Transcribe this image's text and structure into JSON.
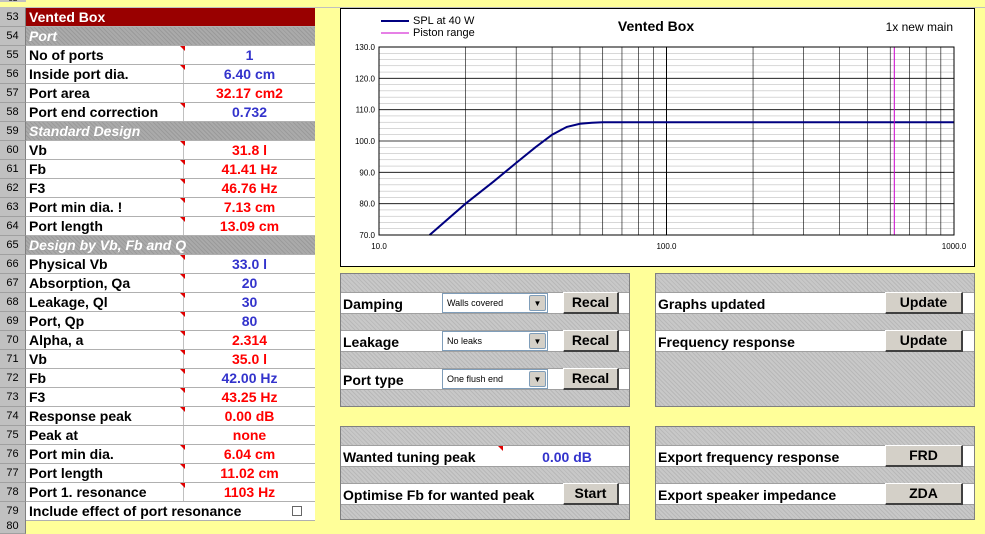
{
  "rows": [
    {
      "num": "53",
      "label": "Vented Box",
      "value": "",
      "style": "title"
    },
    {
      "num": "54",
      "label": "Port",
      "value": "",
      "style": "section"
    },
    {
      "num": "55",
      "label": "No of ports",
      "value": "1",
      "color": "blue",
      "tri": true
    },
    {
      "num": "56",
      "label": "Inside port dia.",
      "value": "6.40 cm",
      "color": "blue",
      "tri": true
    },
    {
      "num": "57",
      "label": "Port area",
      "value": "32.17 cm2",
      "color": "red",
      "tri": false
    },
    {
      "num": "58",
      "label": "Port end correction",
      "value": "0.732",
      "color": "blue",
      "tri": true
    },
    {
      "num": "59",
      "label": "Standard Design",
      "value": "",
      "style": "section"
    },
    {
      "num": "60",
      "label": "Vb",
      "value": "31.8 l",
      "color": "red",
      "tri": true
    },
    {
      "num": "61",
      "label": "Fb",
      "value": "41.41 Hz",
      "color": "red",
      "tri": true
    },
    {
      "num": "62",
      "label": "F3",
      "value": "46.76 Hz",
      "color": "red",
      "tri": true
    },
    {
      "num": "63",
      "label": "Port min dia. !",
      "value": "7.13 cm",
      "color": "red",
      "tri": true
    },
    {
      "num": "64",
      "label": "Port length",
      "value": "13.09 cm",
      "color": "red",
      "tri": true
    },
    {
      "num": "65",
      "label": "Design by Vb, Fb and Q",
      "value": "",
      "style": "section"
    },
    {
      "num": "66",
      "label": "Physical Vb",
      "value": "33.0 l",
      "color": "blue",
      "tri": true
    },
    {
      "num": "67",
      "label": "Absorption, Qa",
      "value": "20",
      "color": "blue",
      "tri": true
    },
    {
      "num": "68",
      "label": "Leakage, Ql",
      "value": "30",
      "color": "blue",
      "tri": true
    },
    {
      "num": "69",
      "label": "Port, Qp",
      "value": "80",
      "color": "blue",
      "tri": true
    },
    {
      "num": "70",
      "label": "Alpha, a",
      "value": "2.314",
      "color": "red",
      "tri": true
    },
    {
      "num": "71",
      "label": "Vb",
      "value": "35.0 l",
      "color": "red",
      "tri": true
    },
    {
      "num": "72",
      "label": "Fb",
      "value": "42.00 Hz",
      "color": "blue",
      "tri": true
    },
    {
      "num": "73",
      "label": "F3",
      "value": "43.25 Hz",
      "color": "red",
      "tri": true
    },
    {
      "num": "74",
      "label": "Response peak",
      "value": "0.00 dB",
      "color": "red",
      "tri": true
    },
    {
      "num": "75",
      "label": "Peak at",
      "value": "none",
      "color": "red",
      "tri": false
    },
    {
      "num": "76",
      "label": "Port min dia.",
      "value": "6.04 cm",
      "color": "red",
      "tri": true
    },
    {
      "num": "77",
      "label": "Port length",
      "value": "11.02 cm",
      "color": "red",
      "tri": true
    },
    {
      "num": "78",
      "label": "Port 1. resonance",
      "value": "1103 Hz",
      "color": "red",
      "tri": true
    },
    {
      "num": "79",
      "label": "Include effect of port resonance",
      "value": "",
      "checkbox": true
    }
  ],
  "row_header_top": "52",
  "row_header_bottom": "80",
  "chart": {
    "title": "Vented Box",
    "subtitle": "1x new main",
    "legend": [
      "SPL at 40 W",
      "Piston range"
    ]
  },
  "chart_data": {
    "type": "line",
    "title": "Vented Box",
    "x_scale": "log",
    "xlim": [
      10,
      1000
    ],
    "ylim": [
      70,
      130
    ],
    "x_ticks": [
      "10.0",
      "100.0",
      "1000.0"
    ],
    "y_ticks": [
      "70.0",
      "80.0",
      "90.0",
      "100.0",
      "110.0",
      "120.0",
      "130.0"
    ],
    "grid": true,
    "legend_position": "top-left",
    "series": [
      {
        "name": "SPL at 40 W",
        "color": "#000080",
        "x": [
          15,
          20,
          25,
          30,
          35,
          40,
          45,
          50,
          55,
          60,
          80,
          100,
          200,
          500,
          1000
        ],
        "y": [
          70,
          80,
          87,
          93,
          98,
          102,
          104.5,
          105.5,
          105.8,
          106,
          106,
          106,
          106,
          106,
          106
        ]
      },
      {
        "name": "Piston range",
        "color": "#cc00cc",
        "x": [
          620,
          620
        ],
        "y": [
          70,
          130
        ]
      }
    ]
  },
  "controls": {
    "damping_label": "Damping",
    "damping_value": "Walls covered",
    "leakage_label": "Leakage",
    "leakage_value": "No leaks",
    "porttype_label": "Port type",
    "porttype_value": "One flush end",
    "recal": "Recal",
    "graphs_updated": "Graphs updated",
    "frequency_response": "Frequency response",
    "update": "Update",
    "wanted_peak_label": "Wanted tuning peak",
    "wanted_peak_value": "0.00 dB",
    "optimise_label": "Optimise Fb for wanted peak",
    "start": "Start",
    "export_frd_label": "Export frequency response",
    "frd": "FRD",
    "export_zda_label": "Export speaker impedance",
    "zda": "ZDA"
  }
}
